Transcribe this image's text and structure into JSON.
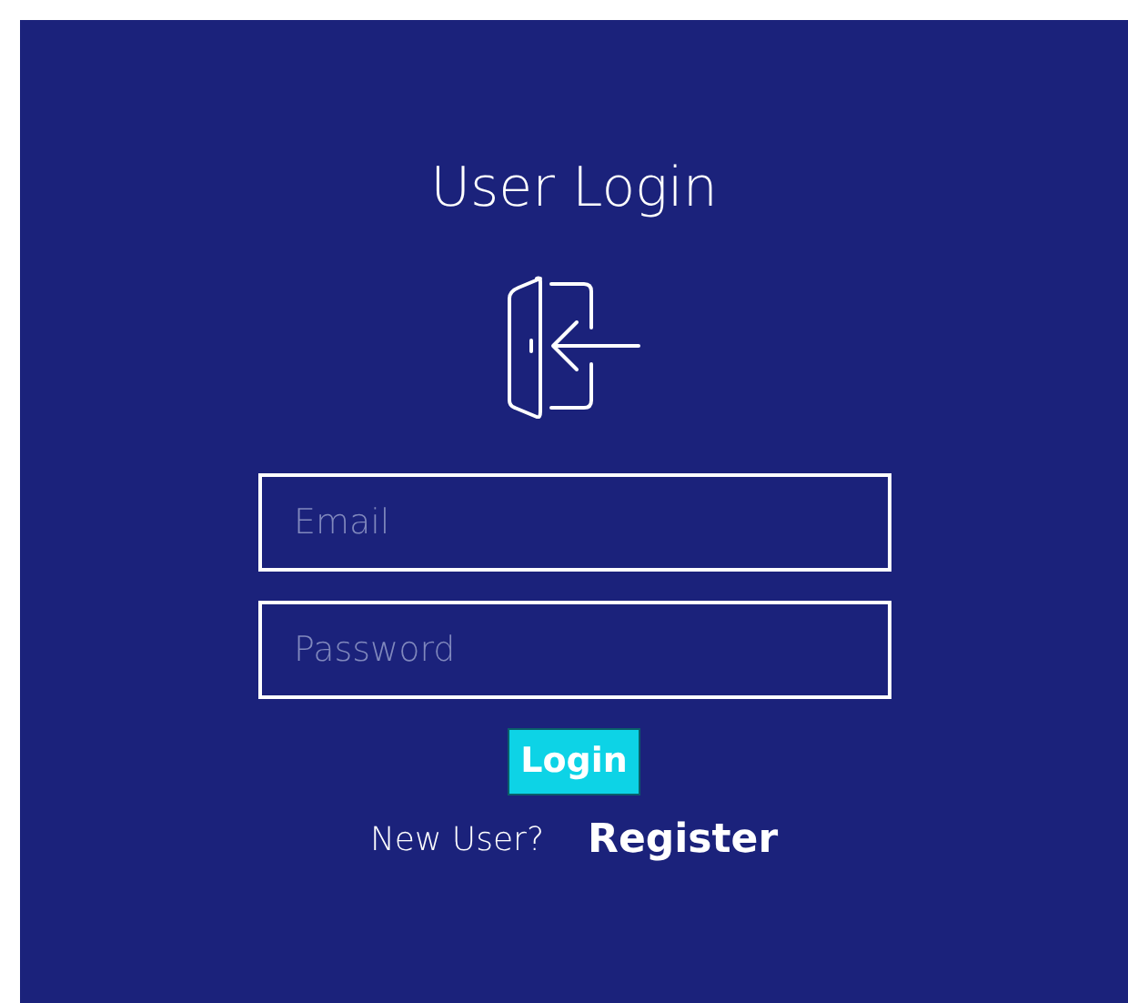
{
  "title": "User Login",
  "fields": [
    {
      "placeholder": "Email"
    },
    {
      "placeholder": "Password"
    }
  ],
  "login_button": "Login",
  "register_prompt": {
    "text": "New User?",
    "link": "Register"
  }
}
